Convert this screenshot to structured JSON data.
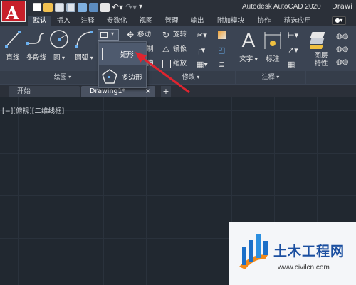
{
  "title_bar": {
    "app_letter": "A",
    "title": "Autodesk AutoCAD 2020",
    "file_title": "Drawi"
  },
  "ribbon_tabs": [
    "默认",
    "插入",
    "注释",
    "参数化",
    "视图",
    "管理",
    "输出",
    "附加模块",
    "协作",
    "精选应用"
  ],
  "active_tab": "默认",
  "draw_panel": {
    "line": "直线",
    "polyline": "多段线",
    "circle": "圆",
    "arc": "圆弧",
    "footer": "绘图"
  },
  "modify_panel": {
    "move": "移动",
    "rotate": "旋转",
    "copy_partial": "制",
    "mirror": "镜像",
    "stretch_partial": "伸",
    "scale": "缩放",
    "footer": "修改"
  },
  "annotation_panel": {
    "text": "文字",
    "dimension": "标注",
    "footer": "注释"
  },
  "layers_panel": {
    "layer_props": "图层\n特性"
  },
  "dropdown": {
    "rectangle": "矩形",
    "polygon": "多边形"
  },
  "doc_tabs": {
    "start": "开始",
    "drawing": "Drawing1*",
    "close": "×",
    "add": "+"
  },
  "viewport_label": "[−][俯视][二维线框]",
  "watermark": {
    "title": "土木工程网",
    "url": "www.civilcn.com"
  },
  "colors": {
    "ribbon_bg": "#3b4453",
    "canvas_bg": "#212830",
    "autocad_red": "#c8202a",
    "arrow_red": "#e0242f"
  }
}
